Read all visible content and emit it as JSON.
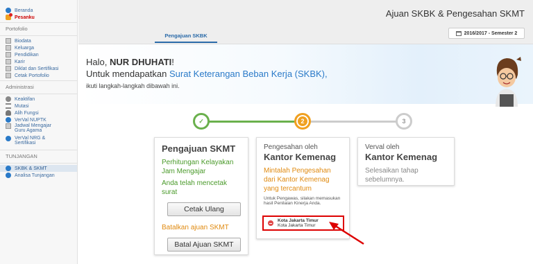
{
  "sidebar": {
    "top_items": [
      {
        "label": "Beranda",
        "icon": "home-icon"
      },
      {
        "label": "Pesanku",
        "icon": "message-icon"
      }
    ],
    "portfolio_title": "Portofolio",
    "portfolio_items": [
      "Biodata",
      "Keluarga",
      "Pendidikan",
      "Karir",
      "Diklat dan Sertifikasi",
      "Cetak Portofolio"
    ],
    "admin_title": "Administrasi",
    "admin_items": [
      "Keaktifan",
      "Mutasi",
      "Alih Fungsi",
      "VerVal NUPTK",
      "Jadwal Mengajar Guru Agama",
      "VerVal NRG & Sertifikasi"
    ],
    "tunjangan_title": "TUNJANGAN",
    "tunjangan_items": [
      "SKBK & SKMT",
      "Analisa Tunjangan"
    ]
  },
  "header": {
    "title": "Ajuan SKBK & Pengesahan SKMT",
    "tab": "Pengajuan SKBK",
    "semester": "2016/2017 - Semester 2"
  },
  "greeting": {
    "hello": "Halo,",
    "name": "NUR DHUHATI",
    "bang": "!",
    "line2_prefix": "Untuk mendapatkan",
    "line2_link": "Surat Keterangan Beban Kerja (SKBK),",
    "line3": "ikuti langkah-langkah dibawah ini."
  },
  "steps": {
    "step1": "✓",
    "step2": "2",
    "step3": "3"
  },
  "card1": {
    "title": "Pengajuan SKMT",
    "text1": "Perhitungan Kelayakan Jam Mengajar",
    "text2": "Anda telah mencetak surat",
    "btn_print": "Cetak Ulang",
    "link_cancel": "Batalkan ajuan SKMT",
    "btn_cancel": "Batal Ajuan SKMT"
  },
  "card2": {
    "sub": "Pengesahan oleh",
    "head": "Kantor Kemenag",
    "text": "Mintalah Pengesahan dari Kantor Kemenag yang tercantum",
    "small": "Untuk Pengawas, silakan memasukan hasil Penilaian Kinerja Anda.",
    "kota_bold": "Kota Jakarta Timur",
    "kota": "Kota Jakarta Timur"
  },
  "card3": {
    "sub": "Verval oleh",
    "head": "Kantor Kemenag",
    "text": "Selesaikan tahap sebelumnya."
  },
  "colors": {
    "accent_blue": "#2a7ac8",
    "green": "#6ab04c",
    "orange": "#f0a020",
    "highlight_red": "#d00000"
  }
}
